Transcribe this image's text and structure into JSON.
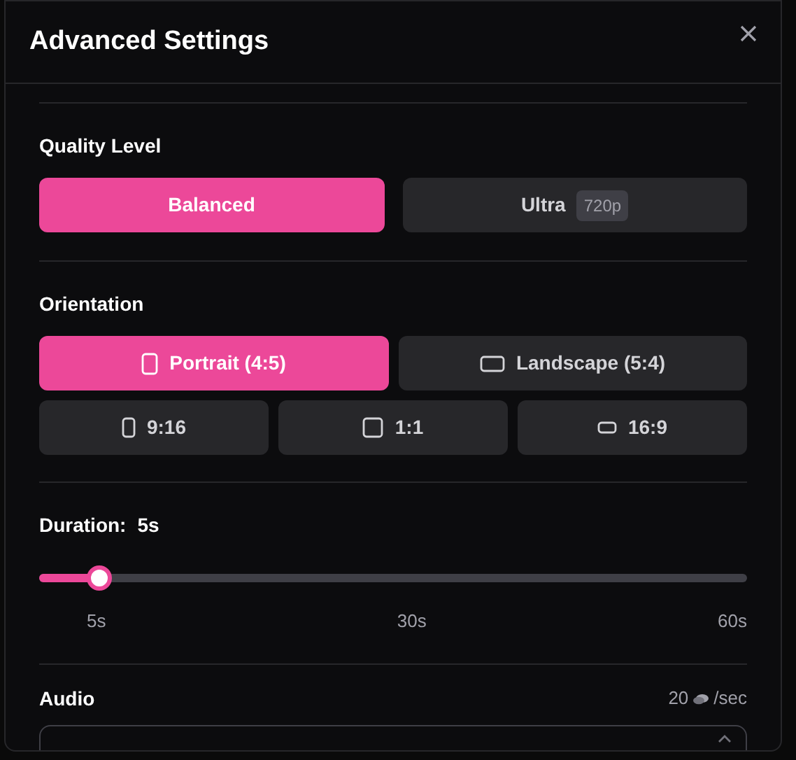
{
  "dialog": {
    "title": "Advanced Settings"
  },
  "quality": {
    "label": "Quality Level",
    "options": [
      {
        "label": "Balanced",
        "selected": true
      },
      {
        "label": "Ultra",
        "badge": "720p",
        "selected": false
      }
    ]
  },
  "orientation": {
    "label": "Orientation",
    "main_options": [
      {
        "label": "Portrait (4:5)",
        "kind": "portrait",
        "selected": true
      },
      {
        "label": "Landscape (5:4)",
        "kind": "landscape",
        "selected": false
      }
    ],
    "ratio_options": [
      {
        "label": "9:16",
        "kind": "tall",
        "selected": false
      },
      {
        "label": "1:1",
        "kind": "square",
        "selected": false
      },
      {
        "label": "16:9",
        "kind": "wide",
        "selected": false
      }
    ]
  },
  "duration": {
    "label": "Duration:",
    "value": "5s",
    "level": 0.084,
    "ticks": [
      "5s",
      "30s",
      "60s"
    ]
  },
  "audio": {
    "label": "Audio",
    "cost": "20",
    "unit": "/sec"
  }
}
